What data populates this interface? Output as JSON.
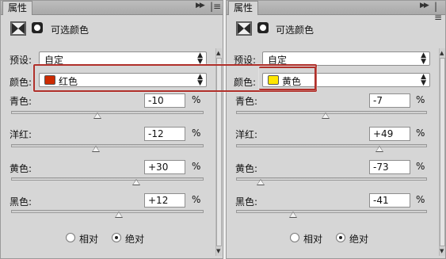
{
  "left": {
    "tab": "属性",
    "panel_title": "可选颜色",
    "preset_label": "预设:",
    "preset_value": "自定",
    "color_label": "颜色:",
    "color_value": "红色",
    "color_swatch": "#cc2a00",
    "sliders": [
      {
        "label": "青色:",
        "value": "-10",
        "pct": "%",
        "level": 0.45
      },
      {
        "label": "洋红:",
        "value": "-12",
        "pct": "%",
        "level": 0.44
      },
      {
        "label": "黄色:",
        "value": "+30",
        "pct": "%",
        "level": 0.65
      },
      {
        "label": "黑色:",
        "value": "+12",
        "pct": "%",
        "level": 0.56
      }
    ],
    "radio_relative": "相对",
    "radio_absolute": "绝对",
    "checked": "absolute"
  },
  "right": {
    "tab": "属性",
    "panel_title": "可选颜色",
    "preset_label": "预设:",
    "preset_value": "自定",
    "color_label": "颜色:",
    "color_value": "黄色",
    "color_swatch": "#ffe600",
    "sliders": [
      {
        "label": "青色:",
        "value": "-7",
        "pct": "%",
        "level": 0.47
      },
      {
        "label": "洋红:",
        "value": "+49",
        "pct": "%",
        "level": 0.75
      },
      {
        "label": "黄色:",
        "value": "-73",
        "pct": "%",
        "level": 0.13
      },
      {
        "label": "黑色:",
        "value": "-41",
        "pct": "%",
        "level": 0.3
      }
    ],
    "radio_relative": "相对",
    "radio_absolute": "绝对",
    "checked": "absolute"
  },
  "highlight_color": "#b0302a"
}
